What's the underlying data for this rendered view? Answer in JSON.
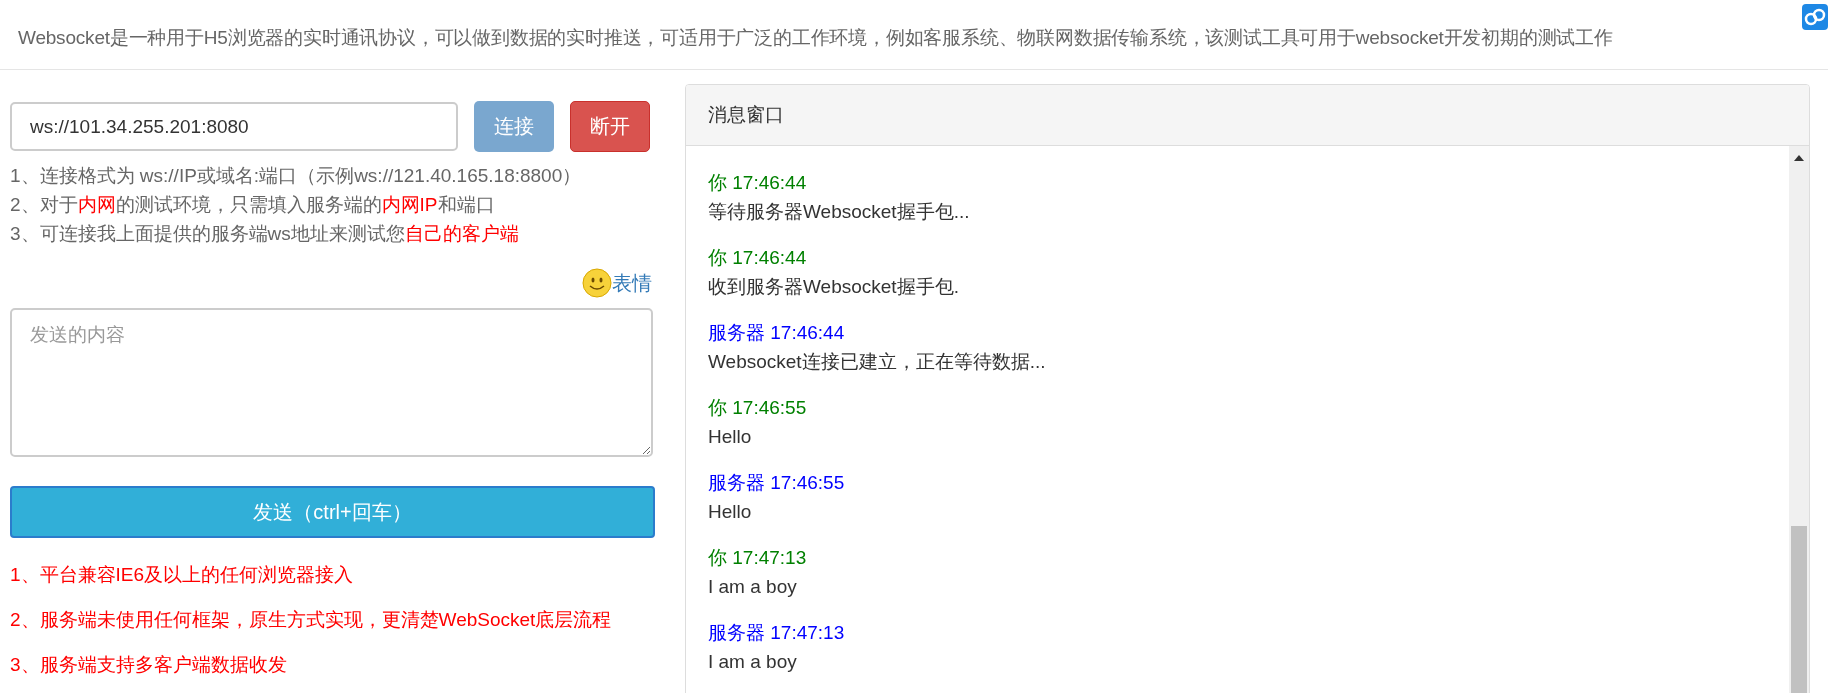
{
  "header": {
    "description": "Websocket是一种用于H5浏览器的实时通讯协议，可以做到数据的实时推送，可适用于广泛的工作环境，例如客服系统、物联网数据传输系统，该测试工具可用于websocket开发初期的测试工作"
  },
  "connection": {
    "url": "ws://101.34.255.201:8080",
    "connect_label": "连接",
    "disconnect_label": "断开"
  },
  "tips": [
    "1、连接格式为 ws://IP或域名:端口（示例ws://121.40.165.18:8800）",
    "2、对于**内网**的测试环境，只需填入服务端的**内网IP**和端口",
    "3、可连接我上面提供的服务端ws地址来测试您**自己的客户端**"
  ],
  "emoji_label": "表情",
  "message_input": {
    "placeholder": "发送的内容"
  },
  "send_label": "发送（ctrl+回车）",
  "features": [
    "1、平台兼容IE6及以上的任何浏览器接入",
    "2、服务端未使用任何框架，原生方式实现，更清楚WebSocket底层流程",
    "3、服务端支持多客户端数据收发"
  ],
  "message_window": {
    "title": "消息窗口",
    "messages": [
      {
        "kind": "you",
        "header": "你 17:46:44",
        "body": "等待服务器Websocket握手包..."
      },
      {
        "kind": "you",
        "header": "你 17:46:44",
        "body": "收到服务器Websocket握手包."
      },
      {
        "kind": "server",
        "header": "服务器 17:46:44",
        "body": "Websocket连接已建立，正在等待数据..."
      },
      {
        "kind": "you",
        "header": "你 17:46:55",
        "body": "Hello"
      },
      {
        "kind": "server",
        "header": "服务器 17:46:55",
        "body": "Hello"
      },
      {
        "kind": "you",
        "header": "你 17:47:13",
        "body": "I am a boy"
      },
      {
        "kind": "server",
        "header": "服务器 17:47:13",
        "body": "I am a boy"
      }
    ]
  }
}
